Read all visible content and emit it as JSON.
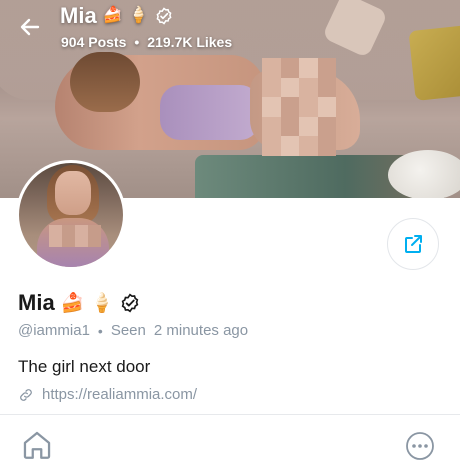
{
  "header": {
    "name": "Mia",
    "posts": "904 Posts",
    "separator": "•",
    "likes": "219.7K Likes",
    "emojis": [
      "cake-emoji",
      "ice-cream-emoji",
      "verified-badge-icon"
    ]
  },
  "profile": {
    "name": "Mia",
    "handle": "@iammia1",
    "separator": "•",
    "seen_label": "Seen",
    "seen_time": "2 minutes ago",
    "bio": "The girl next door",
    "link": "https://realiammia.com/"
  },
  "icons": {
    "back": "arrow-left-icon",
    "share": "share-icon",
    "link": "link-icon",
    "home": "home-icon",
    "more": "more-horizontal-icon",
    "verified": "verified-badge-icon"
  },
  "colors": {
    "muted_text": "#8a96a3",
    "accent": "#00aff0"
  }
}
